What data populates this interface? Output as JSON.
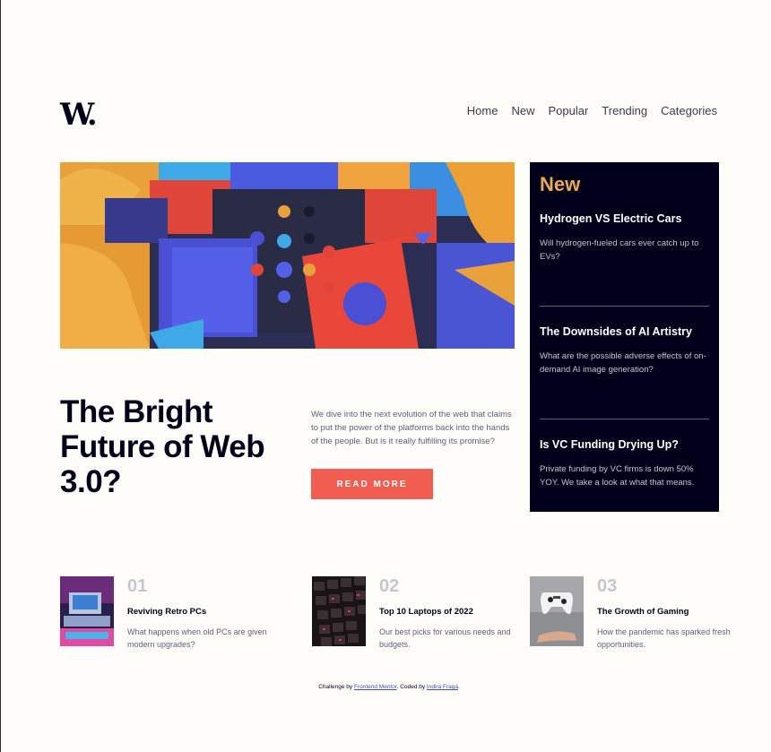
{
  "header": {
    "logo": "W.",
    "nav": [
      "Home",
      "New",
      "Popular",
      "Trending",
      "Categories"
    ]
  },
  "hero": {
    "title": "The Bright Future of Web 3.0?",
    "description": "We dive into the next evolution of the web that claims to put the power of the platforms back into the hands of the people. But is it really fulfilling its promise?",
    "button": "READ MORE"
  },
  "new_panel": {
    "heading": "New",
    "items": [
      {
        "title": "Hydrogen VS Electric Cars",
        "text": "Will hydrogen-fueled cars ever catch up to EVs?"
      },
      {
        "title": "The Downsides of AI Artistry",
        "text": "What are the possible adverse effects of on-demand AI image generation?"
      },
      {
        "title": "Is VC Funding Drying Up?",
        "text": "Private funding by VC firms is down 50% YOY. We take a look at what that means."
      }
    ]
  },
  "cards": [
    {
      "num": "01",
      "title": "Reviving Retro PCs",
      "text": "What happens when old PCs are given modern upgrades?"
    },
    {
      "num": "02",
      "title": "Top 10 Laptops of 2022",
      "text": "Our best picks for various needs and budgets."
    },
    {
      "num": "03",
      "title": "The Growth of Gaming",
      "text": "How the pandemic has sparked fresh opportunities."
    }
  ],
  "footer": {
    "prefix": "Challenge by",
    "link1": "Frontend Mentor",
    "middle": ". Coded by",
    "link2": "Indira Fraga",
    "suffix": "."
  },
  "colors": {
    "accent": "#f15d51",
    "new_heading": "#e9ab53",
    "dark": "#00001a",
    "background": "#fffdfa"
  }
}
